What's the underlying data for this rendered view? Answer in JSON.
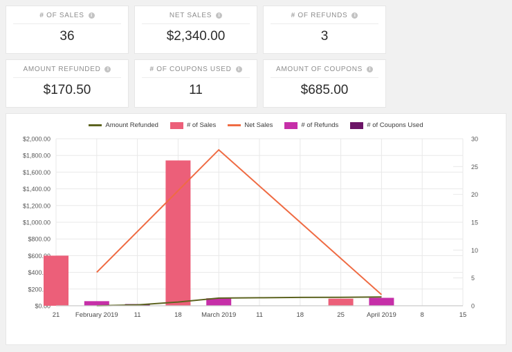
{
  "cards": [
    {
      "label": "# OF SALES",
      "value": "36",
      "info_icon": "info-icon"
    },
    {
      "label": "NET SALES",
      "value": "$2,340.00",
      "info_icon": "info-icon"
    },
    {
      "label": "# OF REFUNDS",
      "value": "3",
      "info_icon": "info-icon"
    },
    {
      "label": "AMOUNT REFUNDED",
      "value": "$170.50",
      "info_icon": "info-icon"
    },
    {
      "label": "# OF COUPONS USED",
      "value": "11",
      "info_icon": "info-icon"
    },
    {
      "label": "AMOUNT OF COUPONS",
      "value": "$685.00",
      "info_icon": "info-icon"
    }
  ],
  "colors": {
    "sales_bar": "#EC5F79",
    "refunds_bar": "#C62FA8",
    "coupons_bar": "#6B1466",
    "net_sales_line": "#EF6B43",
    "amount_refunded_line": "#5C631F",
    "grid": "#e8e8e8",
    "axis": "#c9c9c9",
    "card_bg": "#ffffff",
    "page_bg": "#f1f1f1"
  },
  "chart_data": {
    "type": "bar",
    "title": "",
    "xlabel": "",
    "ylabel": "",
    "grid": true,
    "legend_position": "top-center",
    "x_tick_labels": [
      "21",
      "February 2019",
      "11",
      "18",
      "March 2019",
      "11",
      "18",
      "25",
      "April 2019",
      "8",
      "15"
    ],
    "left_axis": {
      "label": "",
      "ylim": [
        0,
        2000
      ],
      "ticks": [
        "$0.00",
        "$200.00",
        "$400.00",
        "$600.00",
        "$800.00",
        "$1,000.00",
        "$1,200.00",
        "$1,400.00",
        "$1,600.00",
        "$1,800.00",
        "$2,000.00"
      ],
      "tick_values": [
        0,
        200,
        400,
        600,
        800,
        1000,
        1200,
        1400,
        1600,
        1800,
        2000
      ]
    },
    "right_axis": {
      "label": "",
      "ylim": [
        0,
        30
      ],
      "ticks": [
        "0",
        "5",
        "10",
        "15",
        "20",
        "25",
        "30"
      ],
      "tick_values": [
        0,
        5,
        10,
        15,
        20,
        25,
        30
      ]
    },
    "series": [
      {
        "name": "Amount Refunded",
        "kind": "line",
        "axis": "left",
        "color": "#5C631F",
        "points": [
          {
            "x": "February 2019",
            "y": 0
          },
          {
            "x": "11",
            "y": 10
          },
          {
            "x": "18",
            "y": 45
          },
          {
            "x": "March 2019",
            "y": 92
          },
          {
            "x": "11",
            "y": 96
          },
          {
            "x": "18",
            "y": 100
          },
          {
            "x": "25",
            "y": 102
          },
          {
            "x": "April 2019",
            "y": 105
          }
        ]
      },
      {
        "name": "# of Sales",
        "kind": "bar",
        "axis": "left",
        "color": "#EC5F79",
        "bars": [
          {
            "x": "21",
            "y": 600
          },
          {
            "x": "18",
            "y": 1740
          },
          {
            "x": "25",
            "y": 85
          }
        ]
      },
      {
        "name": "Net Sales",
        "kind": "line",
        "axis": "right",
        "color": "#EF6B43",
        "points": [
          {
            "x": "February 2019",
            "y": 6
          },
          {
            "x": "March 2019",
            "y": 28
          },
          {
            "x": "April 2019",
            "y": 2
          }
        ]
      },
      {
        "name": "# of Refunds",
        "kind": "bar",
        "axis": "left",
        "color": "#C62FA8",
        "bars": [
          {
            "x": "February 2019",
            "y": 55
          },
          {
            "x": "March 2019",
            "y": 90
          },
          {
            "x": "April 2019",
            "y": 95
          }
        ]
      },
      {
        "name": "# of Coupons Used",
        "kind": "bar",
        "axis": "left",
        "color": "#6B1466",
        "bars": [
          {
            "x": "11",
            "y": 20
          }
        ]
      }
    ],
    "legend_entries": [
      {
        "label": "Amount Refunded",
        "marker": "line",
        "color": "#5C631F"
      },
      {
        "label": "# of Sales",
        "marker": "bar",
        "color": "#EC5F79"
      },
      {
        "label": "Net Sales",
        "marker": "line",
        "color": "#EF6B43"
      },
      {
        "label": "# of Refunds",
        "marker": "bar",
        "color": "#C62FA8"
      },
      {
        "label": "# of Coupons Used",
        "marker": "bar",
        "color": "#6B1466"
      }
    ]
  }
}
